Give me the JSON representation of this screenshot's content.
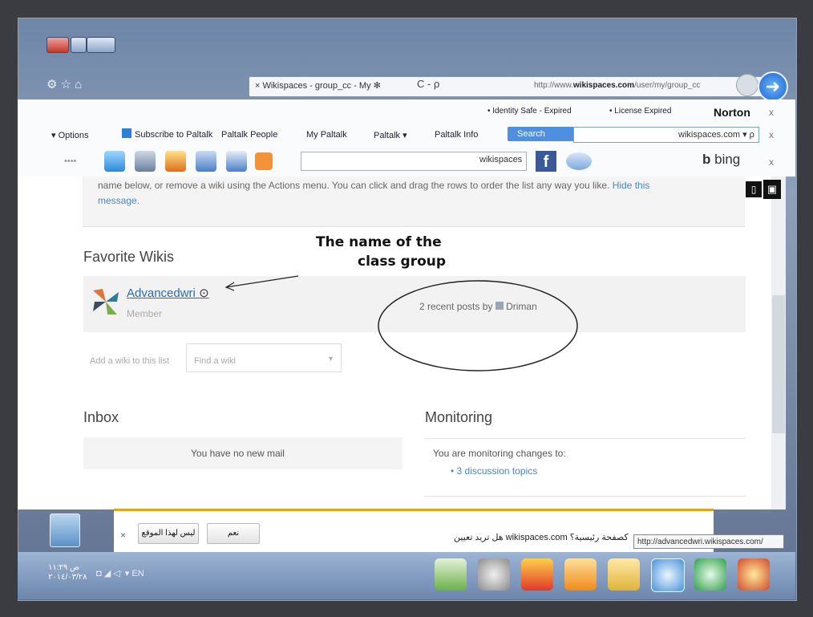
{
  "browser": {
    "tab_title": "Wikispaces - group_cc - My",
    "search_glyph": "C - ρ",
    "url_prefix": "http://www.",
    "url_domain": "wikispaces.com",
    "url_rest": "/user/my/group_cc",
    "go_glyph": "➜",
    "nav_glyphs": "⚙ ☆ ⌂"
  },
  "toolbar1": {
    "identity": "• Identity Safe - Expired",
    "license": "• License Expired",
    "norton": "Norton"
  },
  "toolbar2": {
    "options": "▾ Options",
    "subscribe": "Subscribe to Paltalk",
    "people": "Paltalk People",
    "my_paltalk": "My Paltalk",
    "paltalk": "Paltalk ▾",
    "paltalk_info": "Paltalk Info",
    "search_btn": "Search",
    "search_domain": "wikispaces.com ▾ ρ"
  },
  "toolbar3": {
    "dots": "••••",
    "input_value": "wikispaces",
    "bing": "bing",
    "fb": "f"
  },
  "content": {
    "notice": "name below, or remove a wiki using the Actions menu. You can click and drag the rows to order the list any way you like.",
    "notice_link": "Hide this",
    "notice_link2": "message.",
    "favorite_title": "Favorite Wikis",
    "favorite_wiki": "Advancedwri",
    "favorite_role": "Member",
    "favorite_posts": "2 recent posts by",
    "favorite_user": "Driman",
    "add_label": "Add a wiki to this list",
    "find_placeholder": "Find a wiki",
    "inbox_title": "Inbox",
    "inbox_message": "You have no new mail",
    "monitoring_title": "Monitoring",
    "monitoring_text": "You are monitoring changes to:",
    "monitoring_link": "• 3 discussion topics"
  },
  "annotation": {
    "line1": "The name of the",
    "line2": "class group"
  },
  "notification": {
    "btn_yes": "ليس لهذا الموقع",
    "btn_ok": "نعم",
    "message": "هل تريد تعيين wikispaces.com كصفحة رئيسية؟",
    "url_tooltip": "http://advancedwri.wikispaces.com/"
  },
  "taskbar": {
    "clock_time": "ص ١١:٢٩",
    "clock_date": "٢٠١٤/٠٣/٢٨",
    "tray": "◘ ◢ ◁ˑ ▾  EN"
  },
  "colors": {
    "accent": "#2b6bb6",
    "notif_border": "#e8a21a",
    "facebook": "#3b5998"
  }
}
